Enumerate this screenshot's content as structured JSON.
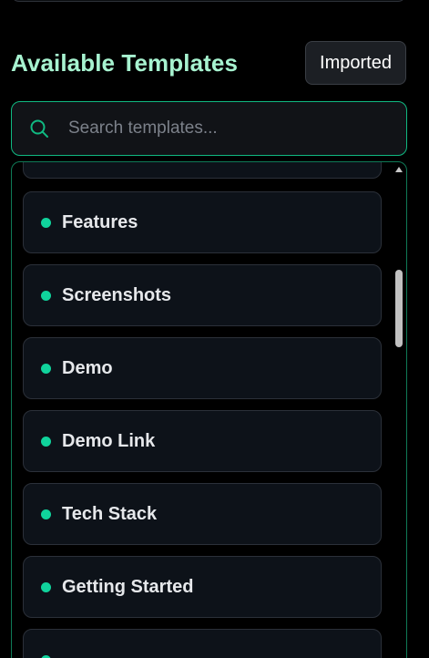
{
  "section": {
    "title": "Available Templates",
    "imported_label": "Imported"
  },
  "search": {
    "icon": "search-icon",
    "placeholder": "Search templates..."
  },
  "templates": [
    {
      "label": ""
    },
    {
      "label": "Features"
    },
    {
      "label": "Screenshots"
    },
    {
      "label": "Demo"
    },
    {
      "label": "Demo Link"
    },
    {
      "label": "Tech Stack"
    },
    {
      "label": "Getting Started"
    },
    {
      "label": ""
    }
  ],
  "colors": {
    "accent": "#10b981",
    "title": "#a7f3d0",
    "dot": "#10d39c",
    "item_bg": "#0d1219"
  }
}
